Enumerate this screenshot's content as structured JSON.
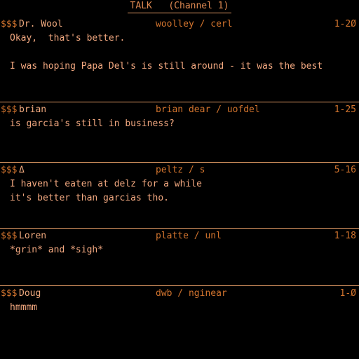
{
  "header": {
    "title": "TALK   (Channel 1)"
  },
  "terminal": {
    "background_color": "#000000",
    "rule_color": "#e09a64",
    "sigil_color": "#d2742e",
    "handle_color": "#f0a97e",
    "account_color": "#d2742e",
    "body_color": "#f2a880"
  },
  "messages": [
    {
      "sigil": "$$$",
      "handle": "Dr. Wool",
      "account": "woolley / cerl",
      "stamp": "1-2Ø",
      "lines": [
        "Okay,  that's better.",
        "",
        "I was hoping Papa Del's is still around - it was the best"
      ],
      "has_rule_above": false
    },
    {
      "sigil": "$$$",
      "handle": "brian",
      "account": "brian dear / uofdel",
      "stamp": "1-25",
      "lines": [
        "is garcia's still in business?"
      ],
      "has_rule_above": true
    },
    {
      "sigil": "$$$",
      "handle": "Δ",
      "account": "peltz / s",
      "stamp": "5-16",
      "lines": [
        "I haven't eaten at delz for a while",
        "it's better than garcias tho."
      ],
      "has_rule_above": true
    },
    {
      "sigil": "$$$",
      "handle": "Loren",
      "account": "platte / unl",
      "stamp": "1-18",
      "lines": [
        "*grin* and *sigh*"
      ],
      "has_rule_above": true
    },
    {
      "sigil": "$$$",
      "handle": "Doug",
      "account": "dwb / nginear",
      "stamp": "1-Ø",
      "lines": [
        "hmmmm"
      ],
      "has_rule_above": true
    }
  ],
  "block_gaps": [
    40,
    44,
    32,
    40,
    0
  ]
}
